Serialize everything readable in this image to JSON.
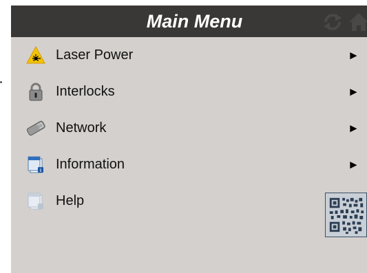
{
  "header": {
    "title": "Main Menu",
    "refresh_icon": "refresh-icon",
    "home_icon": "home-icon",
    "background": "#3a3837"
  },
  "menu": {
    "items": [
      {
        "label": "Laser Power",
        "icon": "laser-warning-icon",
        "arrow": "►"
      },
      {
        "label": "Interlocks",
        "icon": "padlock-icon",
        "arrow": "►"
      },
      {
        "label": "Network",
        "icon": "network-cable-icon",
        "arrow": "►"
      },
      {
        "label": "Information",
        "icon": "information-document-icon",
        "arrow": "►"
      },
      {
        "label": "Help",
        "icon": "help-document-icon"
      }
    ]
  },
  "qr_code": {
    "icon": "qr-code-icon"
  },
  "colors": {
    "screen_bg": "#d4d0cd",
    "text": "#111111",
    "laser_yellow": "#f2c300"
  }
}
